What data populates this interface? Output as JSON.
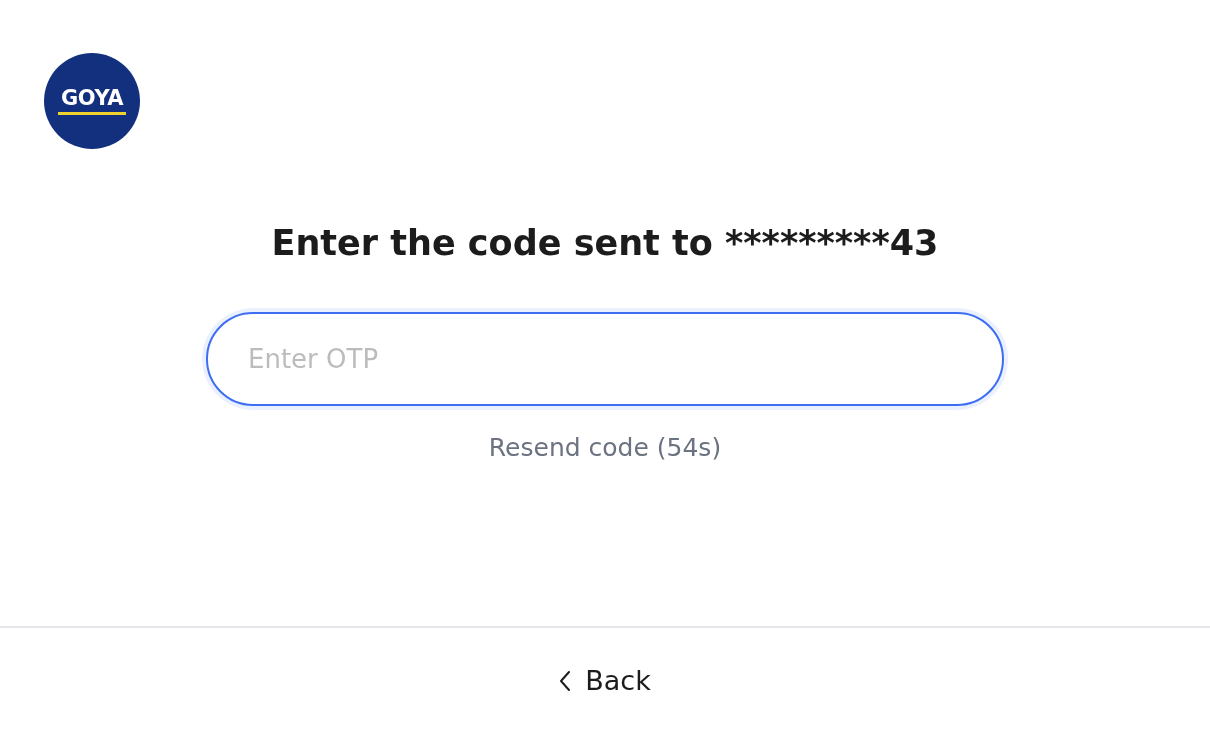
{
  "logo": {
    "text": "GOYA"
  },
  "heading": "Enter the code sent to *********43",
  "otp_field": {
    "placeholder": "Enter OTP",
    "focused": true
  },
  "resend": {
    "label": "Resend code (54s)",
    "disabled": true
  },
  "back_button": {
    "label": "Back"
  }
}
